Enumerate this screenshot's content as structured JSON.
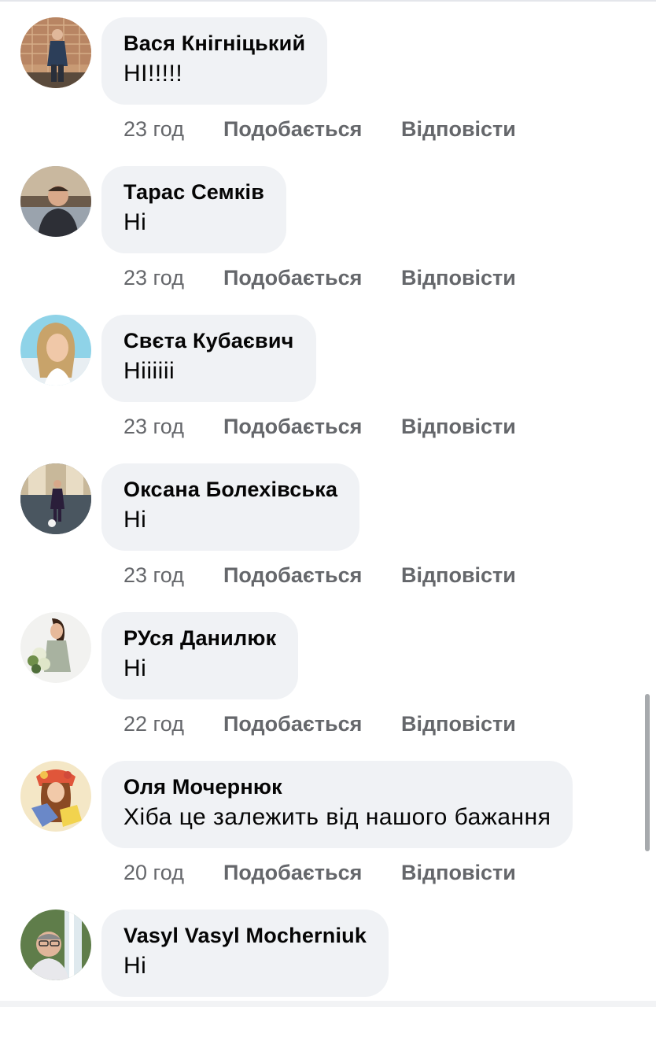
{
  "comments": [
    {
      "author": "Вася Кнігніцький",
      "text": "НІ!!!!!",
      "time": "23 год",
      "like": "Подобається",
      "reply": "Відповісти",
      "avatar_icon": "man-in-suit-avatar"
    },
    {
      "author": "Тарас Семків",
      "text": "Ні",
      "time": "23 год",
      "like": "Подобається",
      "reply": "Відповісти",
      "avatar_icon": "man-portrait-avatar"
    },
    {
      "author": "Свєта Кубаєвич",
      "text": "Ніііііі",
      "time": "23 год",
      "like": "Подобається",
      "reply": "Відповісти",
      "avatar_icon": "woman-selfie-avatar"
    },
    {
      "author": "Оксана Болехівська",
      "text": "Ні",
      "time": "23 год",
      "like": "Подобається",
      "reply": "Відповісти",
      "avatar_icon": "woman-standing-avatar"
    },
    {
      "author": "РУся Данилюк",
      "text": "Ні",
      "time": "22 год",
      "like": "Подобається",
      "reply": "Відповісти",
      "avatar_icon": "woman-flowers-avatar"
    },
    {
      "author": "Оля Мочернюк",
      "text": "Хіба це залежить від нашого бажання",
      "time": "20 год",
      "like": "Подобається",
      "reply": "Відповісти",
      "avatar_icon": "painted-woman-avatar"
    },
    {
      "author": "Vasyl Vasyl Mocherniuk",
      "text": "Ні",
      "time": "",
      "like": "",
      "reply": "",
      "avatar_icon": "man-waterfall-avatar"
    }
  ]
}
